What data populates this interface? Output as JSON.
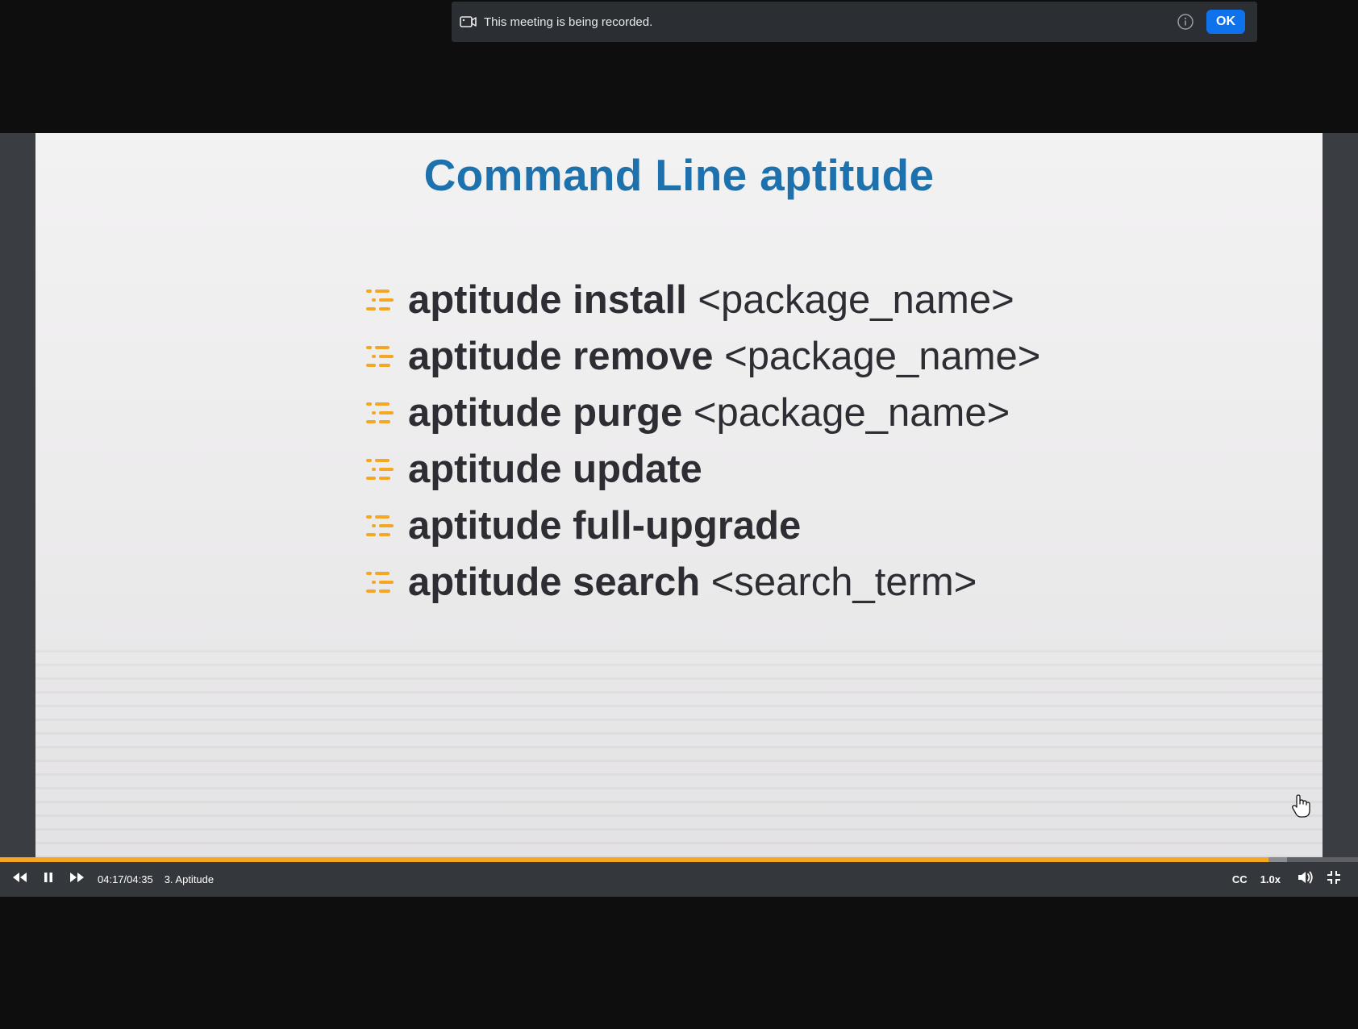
{
  "banner": {
    "message": "This meeting is being recorded.",
    "ok_label": "OK",
    "icons": [
      "video-camera-icon",
      "info-icon"
    ]
  },
  "slide": {
    "title": "Command Line aptitude",
    "commands": [
      {
        "cmd": "aptitude install",
        "arg": "<package_name>"
      },
      {
        "cmd": "aptitude remove",
        "arg": "<package_name>"
      },
      {
        "cmd": "aptitude purge",
        "arg": "<package_name>"
      },
      {
        "cmd": "aptitude update",
        "arg": ""
      },
      {
        "cmd": "aptitude full-upgrade",
        "arg": ""
      },
      {
        "cmd": "aptitude search",
        "arg": "<search_term>"
      }
    ],
    "bullet_icon": "list-bullet-icon",
    "bullet_color": "#f5a623",
    "title_color": "#1d72ad"
  },
  "player": {
    "time": "04:17/04:35",
    "lesson": "3. Aptitude",
    "cc_label": "CC",
    "speed_label": "1.0x",
    "progress_fraction": 0.934,
    "buffered_fraction": 0.948,
    "accent_color": "#f5a623",
    "icons": [
      "rewind-icon",
      "pause-icon",
      "fast-forward-icon",
      "volume-icon",
      "exit-fullscreen-icon"
    ]
  }
}
